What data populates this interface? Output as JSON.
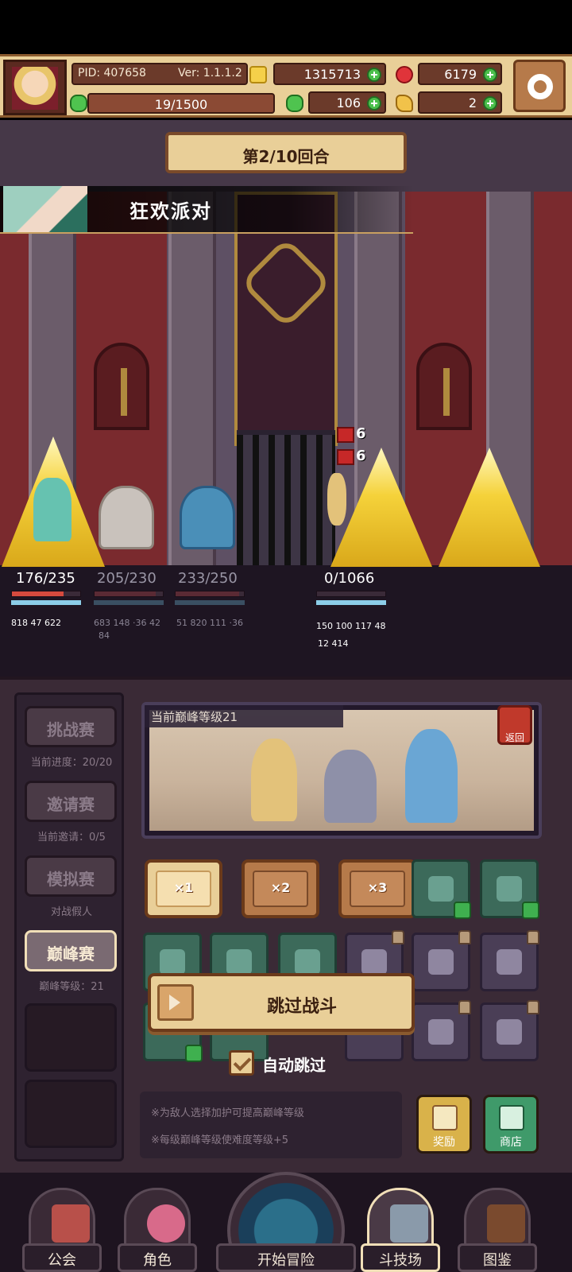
{
  "header": {
    "pid_label": "PID: 407658",
    "version_label": "Ver: 1.1.1.2",
    "gold": "1315713",
    "gems": "6179",
    "stamina": "19/1500",
    "clover": "106",
    "bread": "2"
  },
  "battle": {
    "round": "第2/10回合",
    "event_title": "狂欢派对",
    "debuffs": [
      "6",
      "6"
    ],
    "allies": [
      {
        "hp": "176/235",
        "hp_frac": 0.75,
        "stats": "818  47 622"
      },
      {
        "hp": "205/230",
        "hp_frac": 0.89,
        "stats": "683 148 ·36  42",
        "stats2": "84"
      },
      {
        "hp": "233/250",
        "hp_frac": 0.93,
        "stats": "51 820 111 ·36"
      }
    ],
    "enemy": {
      "hp": "0/1066",
      "hp_frac": 0.0,
      "stats": "150 100 117  48",
      "stats2": "12 414"
    }
  },
  "sidebar": {
    "challenge": {
      "label": "挑战赛",
      "sub": "当前进度：20/20"
    },
    "invite": {
      "label": "邀请赛",
      "sub": "当前邀请：0/5"
    },
    "simulate": {
      "label": "模拟赛",
      "sub": "对战假人"
    },
    "peak": {
      "label": "巅峰赛",
      "sub": "巅峰等级：21"
    }
  },
  "preview": {
    "title": "当前巅峰等级21",
    "return_label": "返回"
  },
  "speed": {
    "x1": "×1",
    "x2": "×2",
    "x3": "×3"
  },
  "skip": {
    "label": "跳过战斗",
    "auto_label": "自动跳过"
  },
  "notes": {
    "line1": "※为敌人选择加护可提高巅峰等级",
    "line2": "※每级巅峰等级使难度等级+5"
  },
  "buttons": {
    "reward": "奖励",
    "shop": "商店"
  },
  "nav": {
    "guild": "公会",
    "character": "角色",
    "adventure": "开始冒险",
    "arena": "斗技场",
    "codex": "图鉴"
  },
  "colors": {
    "header_bg": "#e9cf98",
    "hp_red": "#d64a3e",
    "accent_brown": "#6b3a1a",
    "plus_green": "#4bbf4b"
  },
  "icons": [
    "gold-coin-icon",
    "red-gem-icon",
    "clover-icon",
    "bread-icon",
    "gear-icon",
    "return-icon",
    "skip-arrow-icon",
    "check-icon",
    "lock-icon",
    "reward-chest-icon",
    "shop-icon"
  ]
}
